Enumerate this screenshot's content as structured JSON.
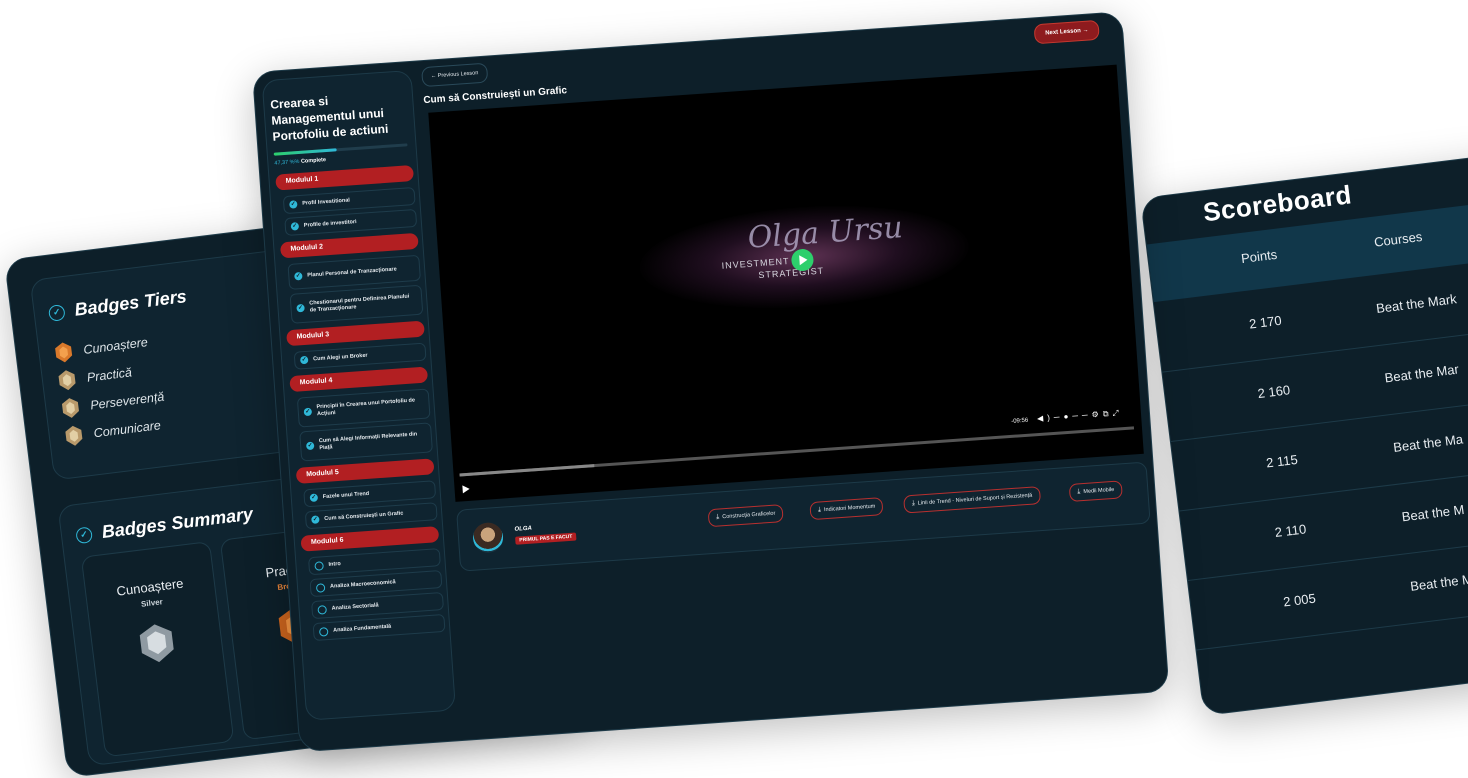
{
  "badges": {
    "tiers_title": "Badges Tiers",
    "tiers": [
      "Cunoaștere",
      "Practică",
      "Perseverență",
      "Comunicare"
    ],
    "summary_title": "Badges Summary",
    "summary": [
      {
        "name": "Cunoaștere",
        "level": "Silver"
      },
      {
        "name": "Practică",
        "level": "Bronze"
      }
    ]
  },
  "scoreboard": {
    "title": "Scoreboard",
    "columns": [
      "Points",
      "Courses"
    ],
    "rows": [
      {
        "points": "2 170",
        "course": "Beat the Mark"
      },
      {
        "points": "2 160",
        "course": "Beat the Mar"
      },
      {
        "points": "2 115",
        "course": "Beat the Ma"
      },
      {
        "points": "2 110",
        "course": "Beat the M"
      },
      {
        "points": "2 005",
        "course": "Beat the M"
      }
    ]
  },
  "course": {
    "title": "Crearea si Managementul unui Portofoliu de actiuni",
    "progress": {
      "value": 47.37,
      "percent_text": "47,37 %%",
      "label": "Complete"
    },
    "modules": [
      {
        "label": "Modulul 1",
        "lessons": [
          {
            "label": "Profil Investitional",
            "done": true
          },
          {
            "label": "Profile de investitori",
            "done": true
          }
        ]
      },
      {
        "label": "Modulul 2",
        "lessons": [
          {
            "label": "Planul Personal de Tranzacționare",
            "done": true
          },
          {
            "label": "Chestionarul pentru Definirea Planului de Tranzacționare",
            "done": true
          }
        ]
      },
      {
        "label": "Modulul 3",
        "lessons": [
          {
            "label": "Cum Alegi un Broker",
            "done": true
          }
        ]
      },
      {
        "label": "Modulul 4",
        "lessons": [
          {
            "label": "Principii în Crearea unui Portofoliu de Acțiuni",
            "done": true
          },
          {
            "label": "Cum să Alegi Informații Relevante din Piață",
            "done": true
          }
        ]
      },
      {
        "label": "Modulul 5",
        "lessons": [
          {
            "label": "Fazele unui Trend",
            "done": true
          },
          {
            "label": "Cum să Construiești un Grafic",
            "done": true
          }
        ]
      },
      {
        "label": "Modulul 6",
        "lessons": [
          {
            "label": "Intro",
            "done": false
          },
          {
            "label": "Analiza Macroeconomică",
            "done": false
          },
          {
            "label": "Analiza Sectorială",
            "done": false
          },
          {
            "label": "Analiza Fundamentală",
            "done": false
          }
        ]
      }
    ],
    "prev_label": "Previous Lesson",
    "next_label": "Next Lesson",
    "lesson_title": "Cum să Construiești un Grafic",
    "video": {
      "logo": "Olga Ursu",
      "sub1": "INVESTMENT",
      "sub2": "STRATEGIST",
      "time": "-09:56"
    },
    "author": {
      "name": "OLGA",
      "tag": "PRIMUL PAS E FACUT"
    },
    "downloads": [
      "Construcția Graficelor",
      "Indicatori Momentum",
      "Linii de Trend - Niveluri de Suport și Rezistență",
      "Medii Mobile"
    ]
  },
  "colors": {
    "bg": "#0d1f29",
    "accent": "#2fb8d8",
    "red": "#b21f22",
    "green": "#2dcf6c"
  }
}
